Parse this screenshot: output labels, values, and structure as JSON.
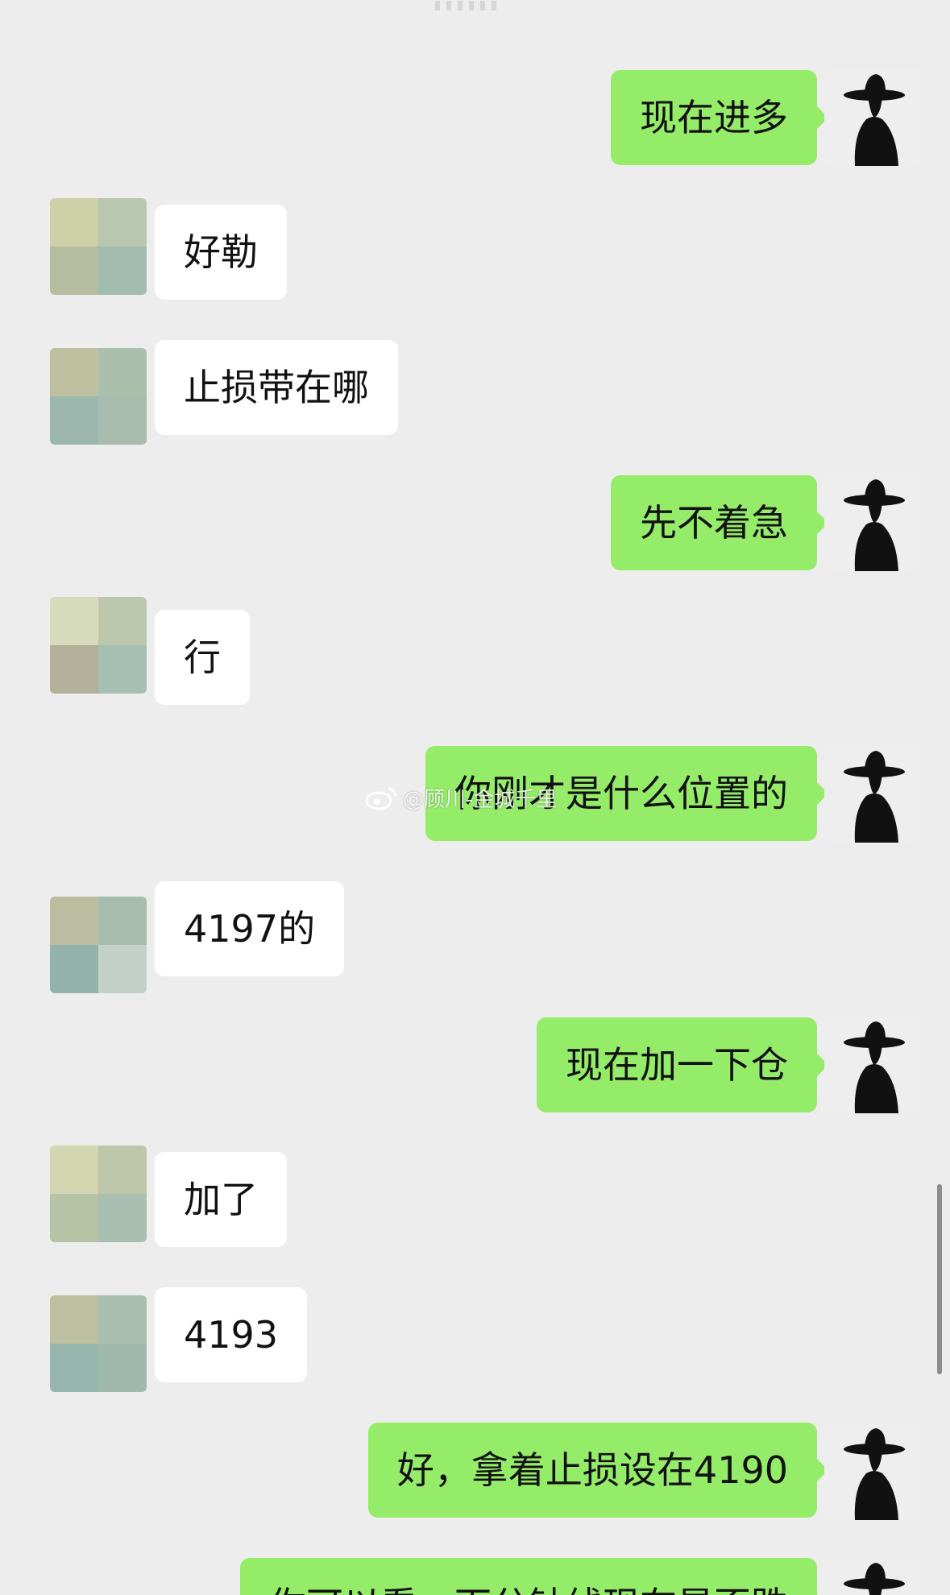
{
  "chat": {
    "messages": [
      {
        "side": "right",
        "text": "现在进多"
      },
      {
        "side": "left",
        "text": "好勒"
      },
      {
        "side": "left",
        "text": "止损带在哪"
      },
      {
        "side": "right",
        "text": "先不着急"
      },
      {
        "side": "left",
        "text": "行"
      },
      {
        "side": "right",
        "text": "你刚才是什么位置的"
      },
      {
        "side": "left",
        "text": "4197的"
      },
      {
        "side": "right",
        "text": "现在加一下仓"
      },
      {
        "side": "left",
        "text": "加了"
      },
      {
        "side": "left",
        "text": "4193"
      },
      {
        "side": "right",
        "text": "好，拿着止损设在4190"
      },
      {
        "side": "right",
        "text": "你可以看一下分钟线现在是否跌"
      }
    ]
  },
  "watermark": {
    "text": "@顾川-金城千里",
    "icon": "weibo-logo-icon"
  },
  "colors": {
    "background": "#ededed",
    "incoming_bubble": "#ffffff",
    "outgoing_bubble": "#95ec69",
    "text": "#111111"
  }
}
